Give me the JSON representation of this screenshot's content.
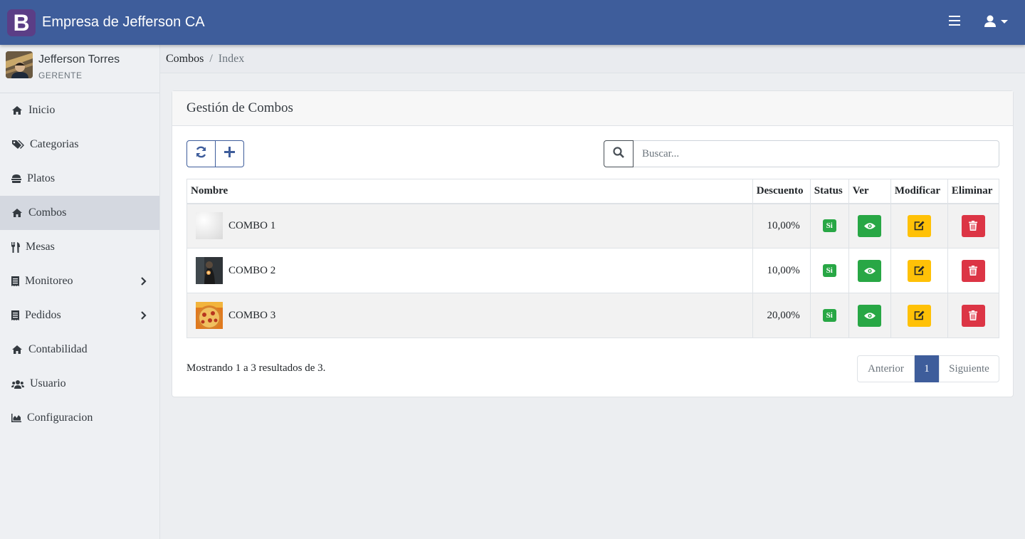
{
  "navbar": {
    "logo_letter": "B",
    "brand": "Empresa de Jefferson CA",
    "menu_icon": "bars-icon",
    "user_icon": "user-dropdown-icon",
    "color": "#3e5d9b"
  },
  "user": {
    "name": "Jefferson Torres",
    "role": "GERENTE"
  },
  "sidebar": {
    "items": [
      {
        "label": "Inicio",
        "icon": "home-icon"
      },
      {
        "label": "Categorias",
        "icon": "tags-icon"
      },
      {
        "label": "Platos",
        "icon": "hamburger-icon"
      },
      {
        "label": "Combos",
        "icon": "home-icon",
        "active": true
      },
      {
        "label": "Mesas",
        "icon": "utensils-icon"
      },
      {
        "label": "Monitoreo",
        "icon": "receipt-icon",
        "has_submenu": true
      },
      {
        "label": "Pedidos",
        "icon": "receipt-icon",
        "has_submenu": true
      },
      {
        "label": "Contabilidad",
        "icon": "home-icon"
      },
      {
        "label": "Usuario",
        "icon": "users-icon"
      },
      {
        "label": "Configuracion",
        "icon": "chart-area-icon"
      }
    ]
  },
  "breadcrumb": {
    "parent": "Combos",
    "separator": "/",
    "current": "Index"
  },
  "card": {
    "title": "Gestión de Combos",
    "search_placeholder": "Buscar...",
    "columns": [
      "Nombre",
      "Descuento",
      "Status",
      "Ver",
      "Modificar",
      "Eliminar"
    ],
    "rows": [
      {
        "name": "COMBO 1",
        "discount": "10,00%",
        "status": "Si"
      },
      {
        "name": "COMBO 2",
        "discount": "10,00%",
        "status": "Si"
      },
      {
        "name": "COMBO 3",
        "discount": "20,00%",
        "status": "Si"
      }
    ],
    "summary": "Mostrando 1 a 3 resultados de 3.",
    "pagination": {
      "prev": "Anterior",
      "current": "1",
      "next": "Siguiente"
    }
  }
}
